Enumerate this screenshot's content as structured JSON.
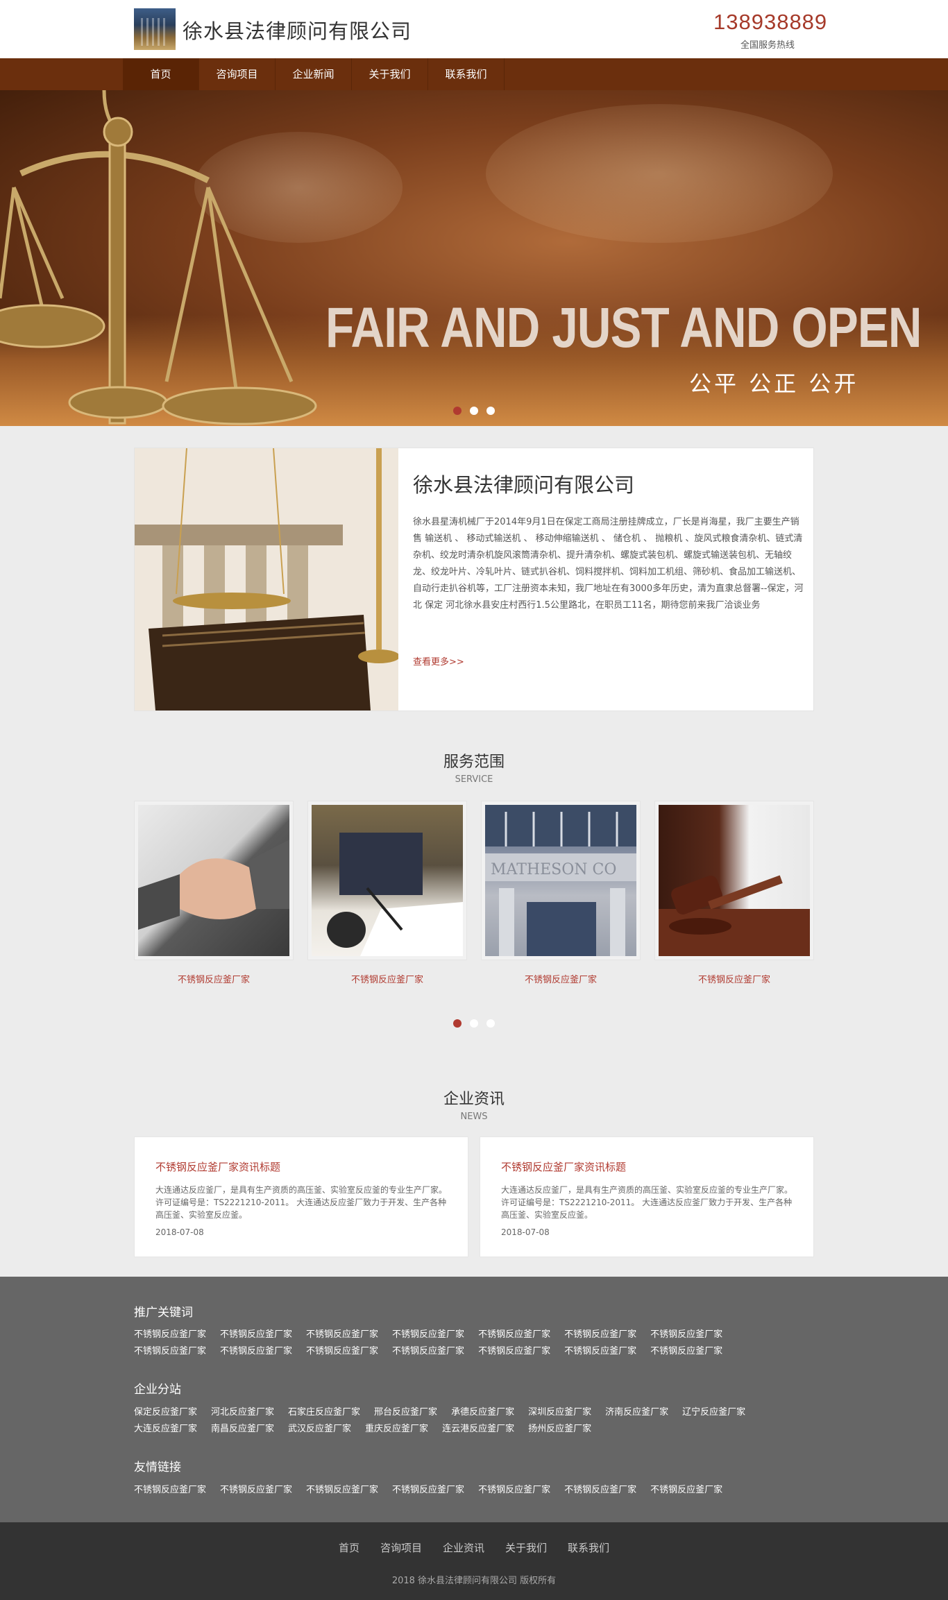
{
  "header": {
    "site_title": "徐水县法律顾问有限公司",
    "hotline_number": "138938889",
    "hotline_label": "全国服务热线"
  },
  "nav": {
    "items": [
      "首页",
      "咨询项目",
      "企业新闻",
      "关于我们",
      "联系我们"
    ],
    "active_index": 0
  },
  "banner": {
    "headline_en": "FAIR AND JUST AND OPEN",
    "headline_cn": "公平  公正  公开",
    "slide_count": 3,
    "active_slide": 0
  },
  "about": {
    "title": "徐水县法律顾问有限公司",
    "text": "徐水县星涛机械厂于2014年9月1日在保定工商局注册挂牌成立，厂长是肖海星，我厂主要生产销售 输送机 、 移动式输送机 、 移动伸缩输送机 、 储仓机 、 抛粮机 、旋风式粮食清杂机、链式清杂机、绞龙时清杂机旋风滚筒清杂机、提升清杂机、螺旋式装包机、螺旋式输送装包机、无轴绞龙、绞龙叶片、冷轧叶片、链式扒谷机、饲料搅拌机、饲料加工机组、筛砂机、食品加工输送机、自动行走扒谷机等，工厂注册资本未知，我厂地址在有3000多年历史，清为直隶总督署--保定，河北 保定 河北徐水县安庄村西行1.5公里路北，在职员工11名，期待您前来我厂洽谈业务",
    "more_link": "查看更多>>"
  },
  "services": {
    "heading": "服务范围",
    "subheading": "SERVICE",
    "items": [
      {
        "label": "不锈钢反应釜厂家",
        "image": "handshake-photo"
      },
      {
        "label": "不锈钢反应釜厂家",
        "image": "signing-document-photo"
      },
      {
        "label": "不锈钢反应釜厂家",
        "image": "law-building-photo"
      },
      {
        "label": "不锈钢反应釜厂家",
        "image": "gavel-photo"
      }
    ],
    "slide_count": 3,
    "active_slide": 0
  },
  "news": {
    "heading": "企业资讯",
    "subheading": "NEWS",
    "items": [
      {
        "title": "不锈钢反应釜厂家资讯标题",
        "body": "大连通达反应釜厂，是具有生产资质的高压釜、实验室反应釜的专业生产厂家。许可证编号是：TS2221210-2011。 大连通达反应釜厂致力于开发、生产各种高压釜、实验室反应釜。",
        "date": "2018-07-08"
      },
      {
        "title": "不锈钢反应釜厂家资讯标题",
        "body": "大连通达反应釜厂，是具有生产资质的高压釜、实验室反应釜的专业生产厂家。许可证编号是：TS2221210-2011。 大连通达反应釜厂致力于开发、生产各种高压釜、实验室反应釜。",
        "date": "2018-07-08"
      }
    ]
  },
  "footer": {
    "keywords_heading": "推广关键词",
    "keywords": [
      "不锈钢反应釜厂家",
      "不锈钢反应釜厂家",
      "不锈钢反应釜厂家",
      "不锈钢反应釜厂家",
      "不锈钢反应釜厂家",
      "不锈钢反应釜厂家",
      "不锈钢反应釜厂家",
      "不锈钢反应釜厂家",
      "不锈钢反应釜厂家",
      "不锈钢反应釜厂家",
      "不锈钢反应釜厂家",
      "不锈钢反应釜厂家",
      "不锈钢反应釜厂家",
      "不锈钢反应釜厂家"
    ],
    "branches_heading": "企业分站",
    "branches": [
      "保定反应釜厂家",
      "河北反应釜厂家",
      "石家庄反应釜厂家",
      "邢台反应釜厂家",
      "承德反应釜厂家",
      "深圳反应釜厂家",
      "济南反应釜厂家",
      "辽宁反应釜厂家",
      "大连反应釜厂家",
      "南昌反应釜厂家",
      "武汉反应釜厂家",
      "重庆反应釜厂家",
      "连云港反应釜厂家",
      "扬州反应釜厂家"
    ],
    "links_heading": "友情链接",
    "links": [
      "不锈钢反应釜厂家",
      "不锈钢反应釜厂家",
      "不锈钢反应釜厂家",
      "不锈钢反应釜厂家",
      "不锈钢反应釜厂家",
      "不锈钢反应釜厂家",
      "不锈钢反应釜厂家"
    ],
    "nav": [
      "首页",
      "咨询项目",
      "企业资讯",
      "关于我们",
      "联系我们"
    ],
    "copyright": "2018 徐水县法律顾问有限公司 版权所有"
  }
}
